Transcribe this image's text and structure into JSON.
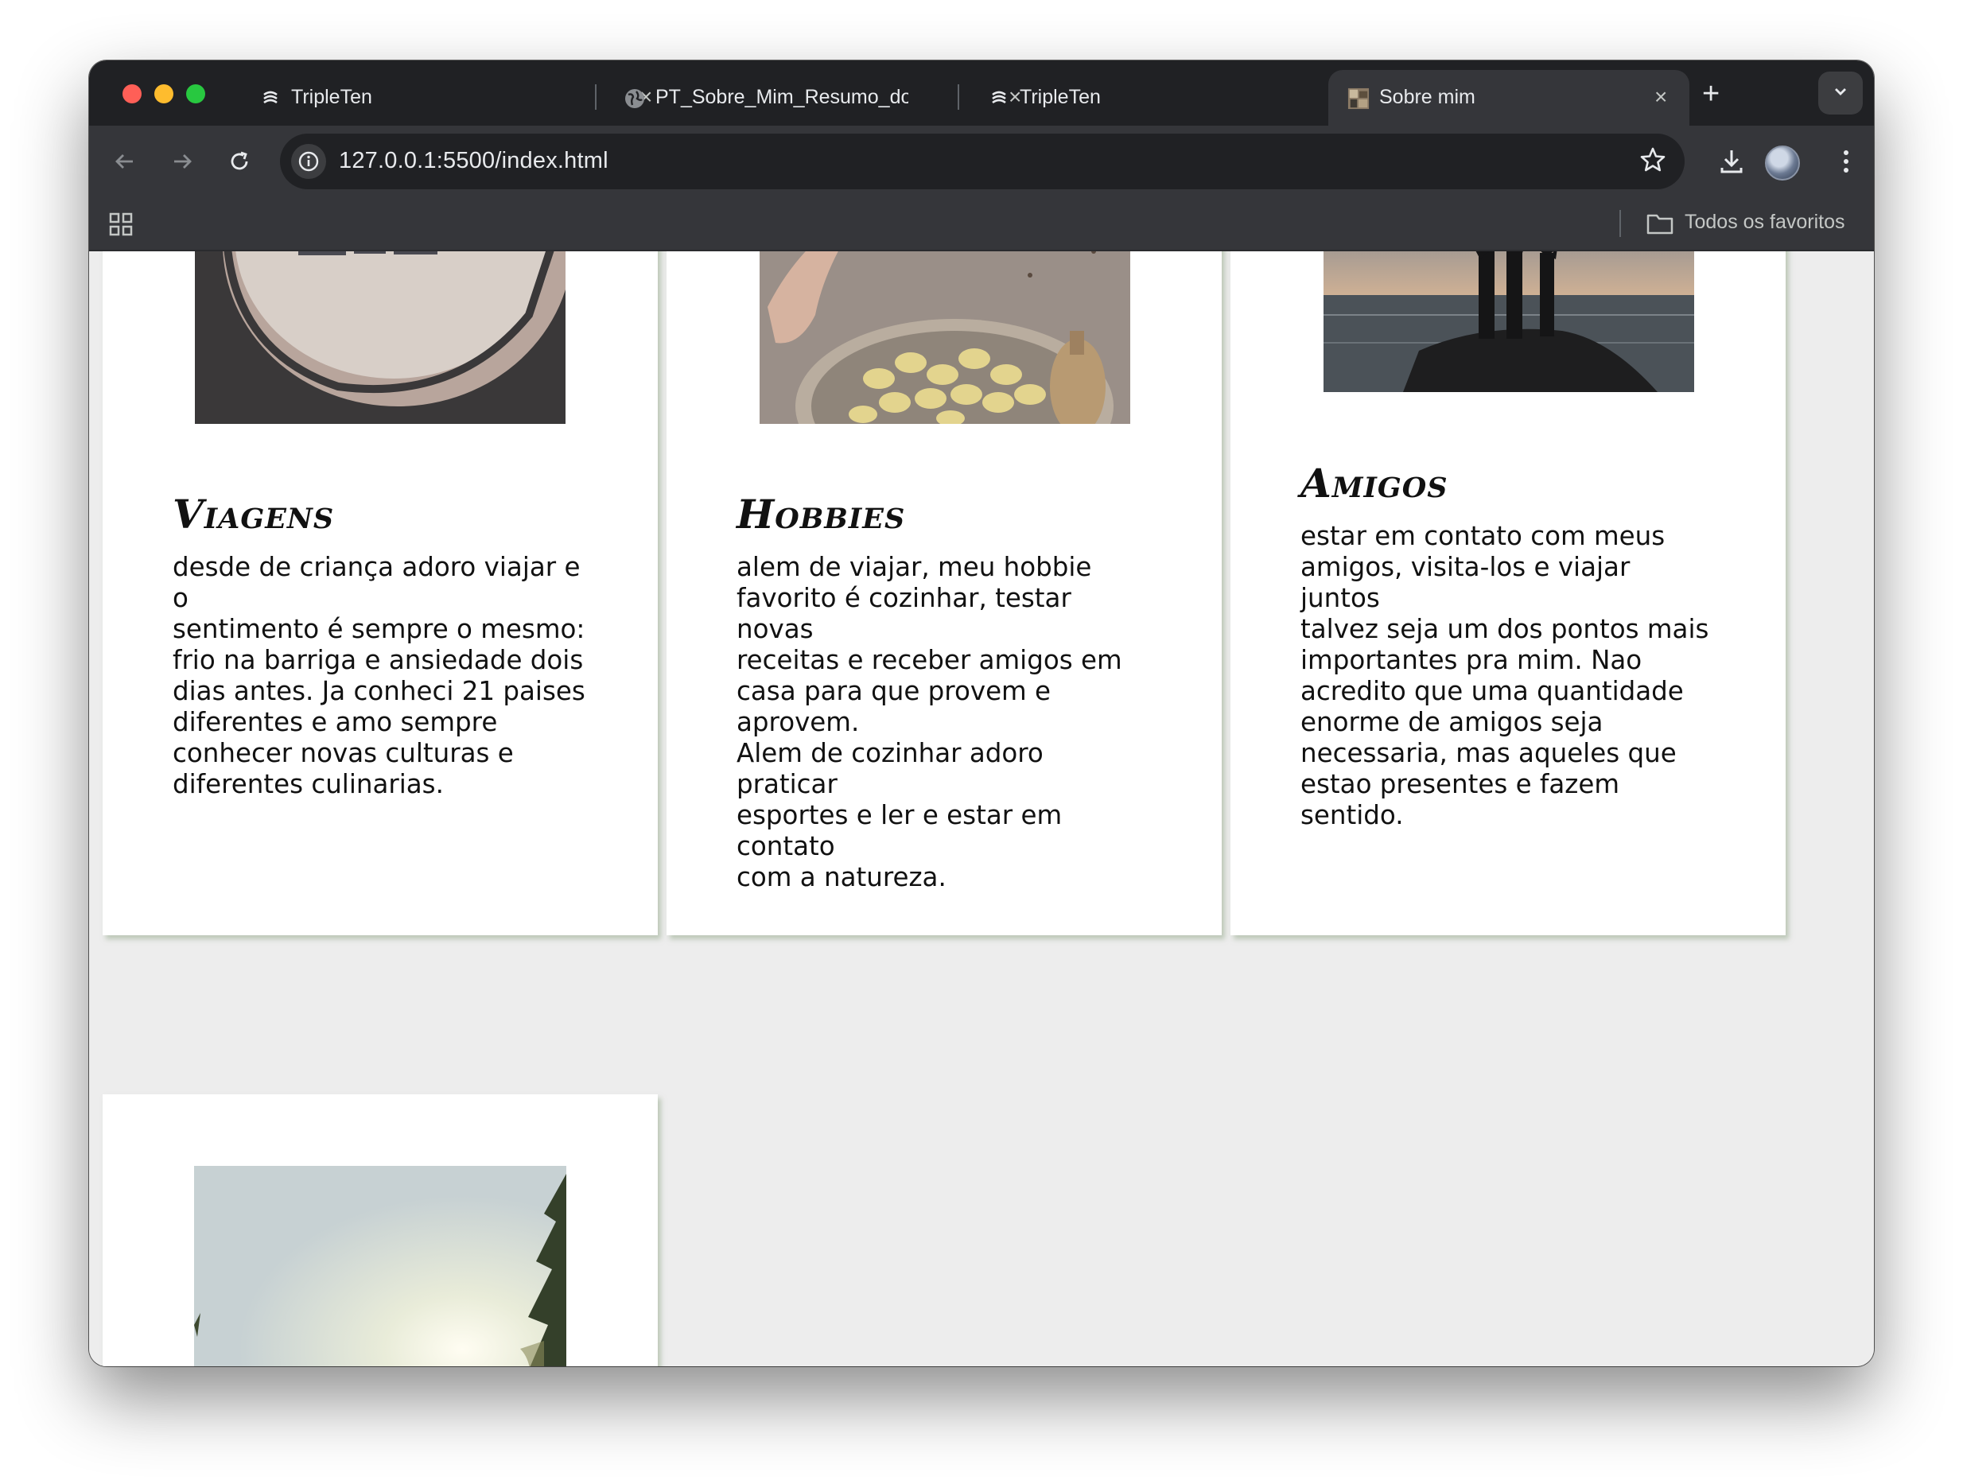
{
  "browser": {
    "tabs": [
      {
        "title": "TripleTen",
        "favicon": "tripleten-icon",
        "active": false
      },
      {
        "title": "PT_Sobre_Mim_Resumo_do",
        "favicon": "globe-icon",
        "active": false
      },
      {
        "title": "TripleTen",
        "favicon": "tripleten-icon",
        "active": false
      },
      {
        "title": "Sobre mim",
        "favicon": "page-thumbnail-icon",
        "active": true
      }
    ],
    "url": "127.0.0.1:5500/index.html",
    "bookmarks_folder": "Todos os favoritos"
  },
  "page": {
    "cards": [
      {
        "title": "Viagens",
        "image": "airplane-window-photo",
        "text_lines": [
          "desde de criança adoro viajar e o",
          "sentimento é sempre o mesmo:",
          "frio na barriga e ansiedade dois",
          "dias antes. Ja conheci 21 paises",
          "diferentes e amo sempre",
          "conhecer novas culturas e",
          "diferentes culinarias."
        ]
      },
      {
        "title": "Hobbies",
        "image": "gnocchi-plate-photo",
        "text_lines": [
          "alem de viajar, meu hobbie",
          "favorito é cozinhar, testar novas",
          "receitas e receber amigos em",
          "casa para que provem e aprovem.",
          "Alem de cozinhar adoro praticar",
          "esportes e ler e estar em contato",
          "com a natureza."
        ]
      },
      {
        "title": "Amigos",
        "image": "friends-silhouette-photo",
        "text_lines": [
          "estar em contato com meus",
          "amigos, visita-los e viajar juntos",
          "talvez seja um dos pontos mais",
          "importantes pra mim. Nao",
          "acredito que uma quantidade",
          "enorme de amigos seja",
          "necessaria, mas aqueles que",
          "estao presentes e fazem sentido."
        ]
      },
      {
        "title": "",
        "image": "forest-sunlight-photo",
        "text_lines": []
      }
    ]
  }
}
